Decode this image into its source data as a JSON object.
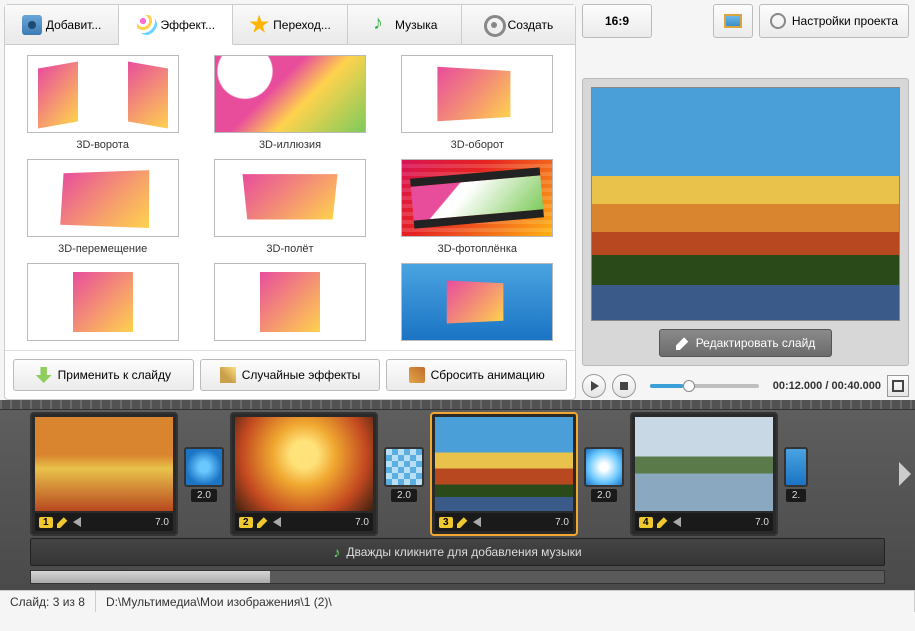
{
  "tabs": {
    "add": "Добавит...",
    "effects": "Эффект...",
    "transitions": "Переход...",
    "music": "Музыка",
    "create": "Создать"
  },
  "effects": [
    {
      "label": "3D-ворота"
    },
    {
      "label": "3D-иллюзия"
    },
    {
      "label": "3D-оборот"
    },
    {
      "label": "3D-перемещение"
    },
    {
      "label": "3D-полёт"
    },
    {
      "label": "3D-фотоплёнка"
    }
  ],
  "buttons": {
    "apply": "Применить к слайду",
    "random": "Случайные эффекты",
    "reset": "Сбросить анимацию"
  },
  "right": {
    "aspect": "16:9",
    "settings": "Настройки проекта",
    "edit": "Редактировать слайд",
    "time": "00:12.000 / 00:40.000"
  },
  "timeline": {
    "slides": [
      {
        "num": "1",
        "dur": "7.0"
      },
      {
        "num": "2",
        "dur": "7.0"
      },
      {
        "num": "3",
        "dur": "7.0"
      },
      {
        "num": "4",
        "dur": "7.0"
      }
    ],
    "transitions": [
      {
        "dur": "2.0"
      },
      {
        "dur": "2.0"
      },
      {
        "dur": "2.0"
      },
      {
        "dur": "2."
      }
    ],
    "music_hint": "Дважды кликните для добавления музыки"
  },
  "status": {
    "slide": "Слайд: 3 из 8",
    "path": "D:\\Мультимедиа\\Мои изображения\\1 (2)\\"
  }
}
